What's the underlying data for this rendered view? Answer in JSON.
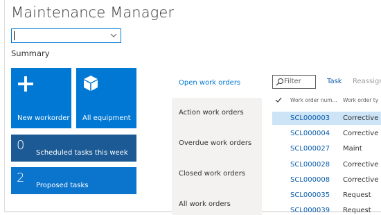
{
  "app": {
    "title": "Maintenance Manager"
  },
  "selector": {
    "value": ""
  },
  "summary": {
    "label": "Summary"
  },
  "tiles": {
    "new_workorder": {
      "label": "New workorder",
      "icon": "plus-icon"
    },
    "all_equipment": {
      "label": "All equipment",
      "icon": "cube-icon"
    },
    "scheduled": {
      "count": "0",
      "label": "Scheduled tasks this week"
    },
    "proposed": {
      "count": "2",
      "label": "Proposed tasks"
    }
  },
  "nav": {
    "items": [
      {
        "label": "Open work orders",
        "active": true
      },
      {
        "label": "Action work orders",
        "active": false
      },
      {
        "label": "Overdue work orders",
        "active": false
      },
      {
        "label": "Closed work orders",
        "active": false
      },
      {
        "label": "All work orders",
        "active": false
      }
    ]
  },
  "toolbar": {
    "filter_placeholder": "Filter",
    "task_label": "Task",
    "reassign_label": "Reassign"
  },
  "grid": {
    "columns": [
      "Work order num...",
      "Work order ty"
    ],
    "rows": [
      {
        "id": "SCL000003",
        "type": "Corrective",
        "selected": true
      },
      {
        "id": "SCL000004",
        "type": "Corrective",
        "selected": false
      },
      {
        "id": "SCL000027",
        "type": "Maint",
        "selected": false
      },
      {
        "id": "SCL000028",
        "type": "Corrective",
        "selected": false
      },
      {
        "id": "SCL000008",
        "type": "Corrective",
        "selected": false
      },
      {
        "id": "SCL000035",
        "type": "Request",
        "selected": false
      },
      {
        "id": "SCL000039",
        "type": "Request",
        "selected": false
      }
    ]
  },
  "colors": {
    "accent": "#0078d4",
    "tile_dark": "#1b5a94",
    "selected_row": "#cce4f6",
    "nav_bg": "#f3f2f1"
  }
}
